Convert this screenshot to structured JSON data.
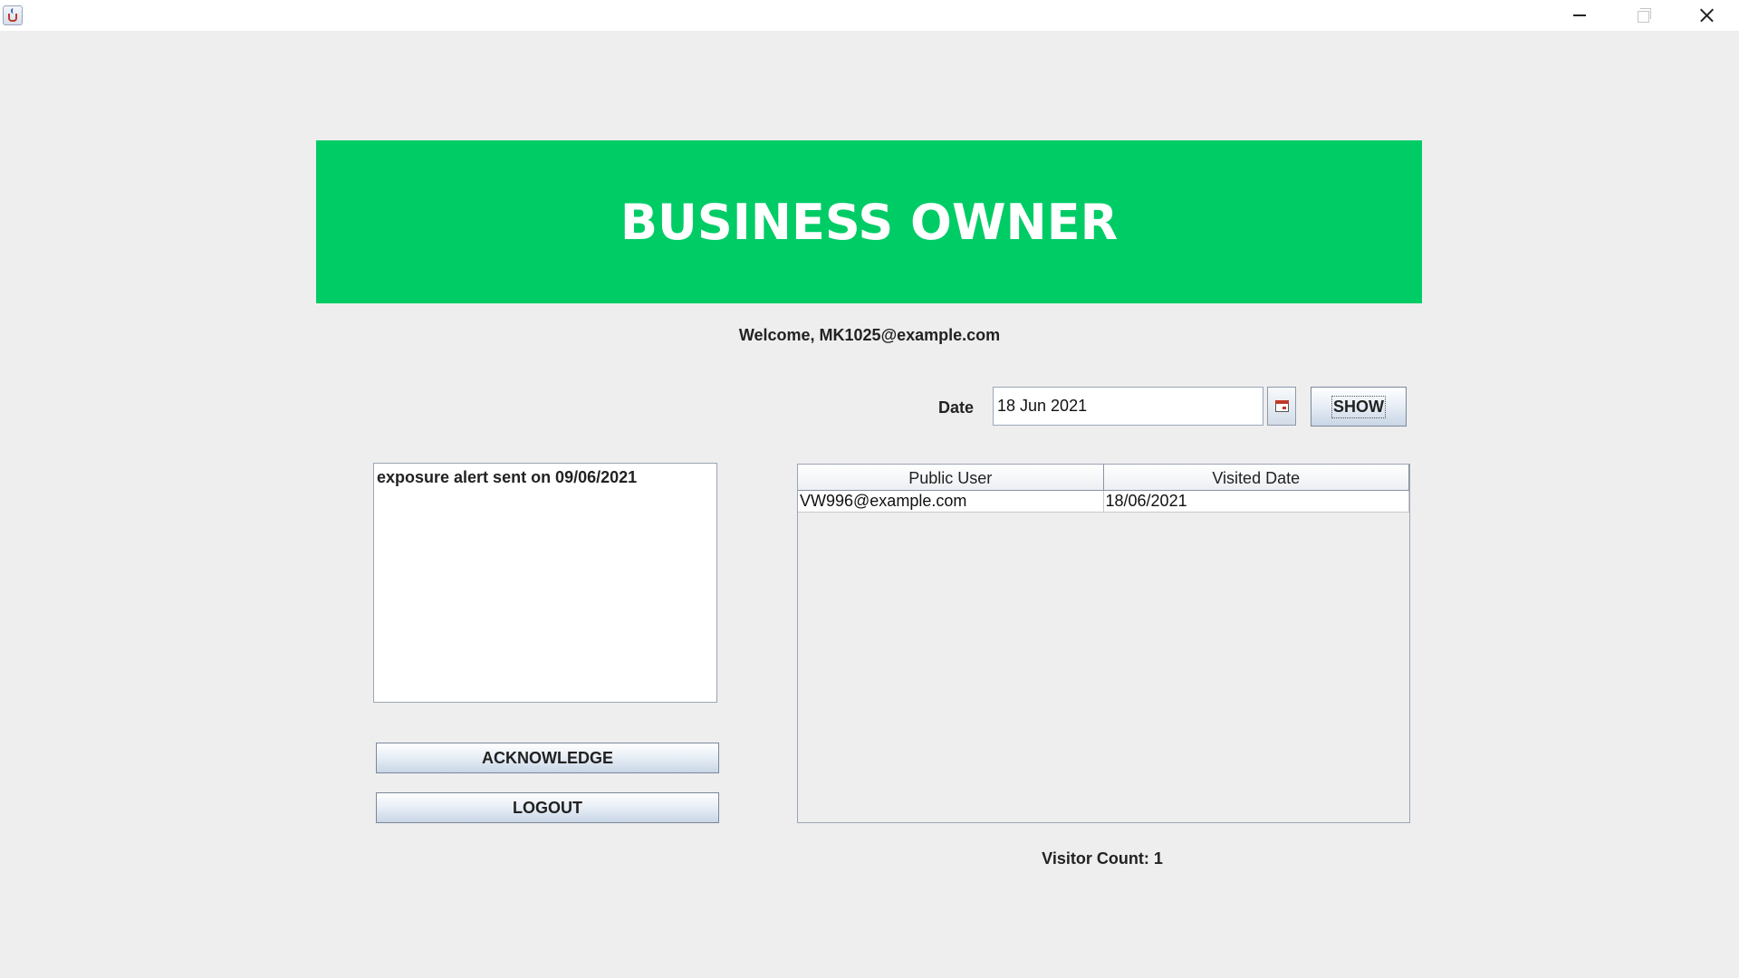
{
  "window": {
    "app_icon": "java-cup-icon",
    "controls": [
      "minimize-icon",
      "restore-icon",
      "close-icon"
    ]
  },
  "banner": {
    "title": "BUSINESS OWNER",
    "color": "#00cc66"
  },
  "welcome_text": "Welcome, MK1025@example.com",
  "date_filter": {
    "label": "Date",
    "value": "18 Jun 2021",
    "calendar_icon": "calendar-icon",
    "show_label": "SHOW"
  },
  "alerts": {
    "items": [
      "exposure alert sent on 09/06/2021"
    ]
  },
  "actions": {
    "acknowledge_label": "ACKNOWLEDGE",
    "logout_label": "LOGOUT"
  },
  "visitors_table": {
    "headers": [
      "Public User",
      "Visited Date"
    ],
    "rows": [
      [
        "VW996@example.com",
        "18/06/2021"
      ]
    ]
  },
  "visitor_count_text": "Visitor Count: 1"
}
